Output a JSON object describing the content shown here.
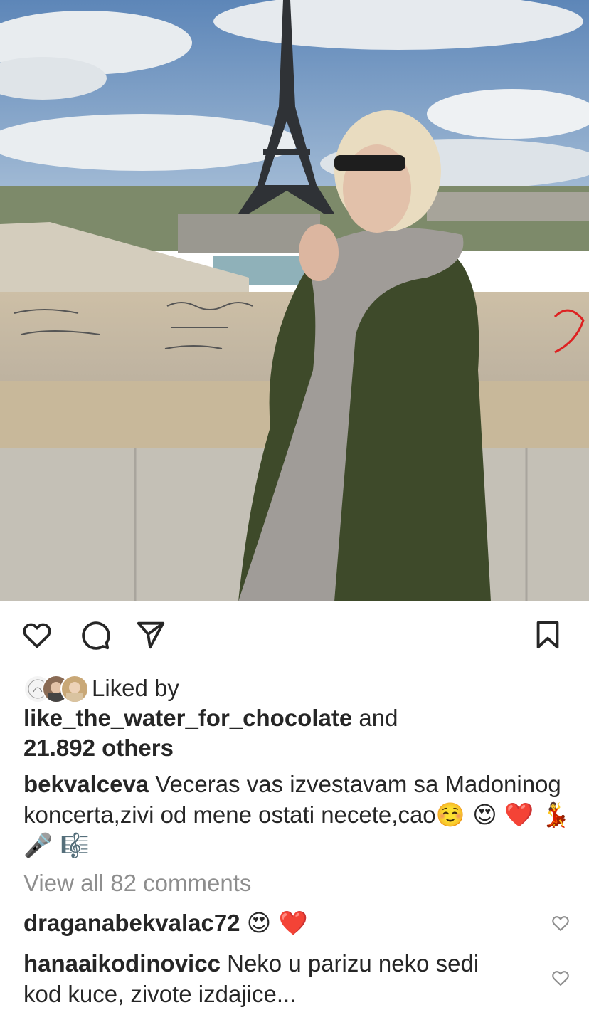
{
  "post": {
    "likes": {
      "prefix": "Liked by",
      "user": "like_the_water_for_chocolate",
      "and": "and",
      "count_text": "21.892 others"
    },
    "caption": {
      "username": "bekvalceva",
      "text": "Veceras vas izvestavam sa Madoninog koncerta,zivi od mene ostati necete,cao",
      "emojis": "☺️ 😍 ❤️ 💃 🎤 🎼"
    },
    "view_all_comments": "View all 82 comments",
    "comments": [
      {
        "username": "draganabekvalac72",
        "text": "😍 ❤️"
      },
      {
        "username": "hanaaikodinovicc",
        "text": "Neko u parizu neko sedi kod kuce, zivote izdajice..."
      }
    ]
  },
  "icons": {
    "like": "heart-icon",
    "comment": "comment-bubble-icon",
    "share": "paper-plane-icon",
    "save": "bookmark-icon"
  },
  "colors": {
    "text": "#262626",
    "muted": "#8e8e8e",
    "heart_red": "#ed4956"
  }
}
